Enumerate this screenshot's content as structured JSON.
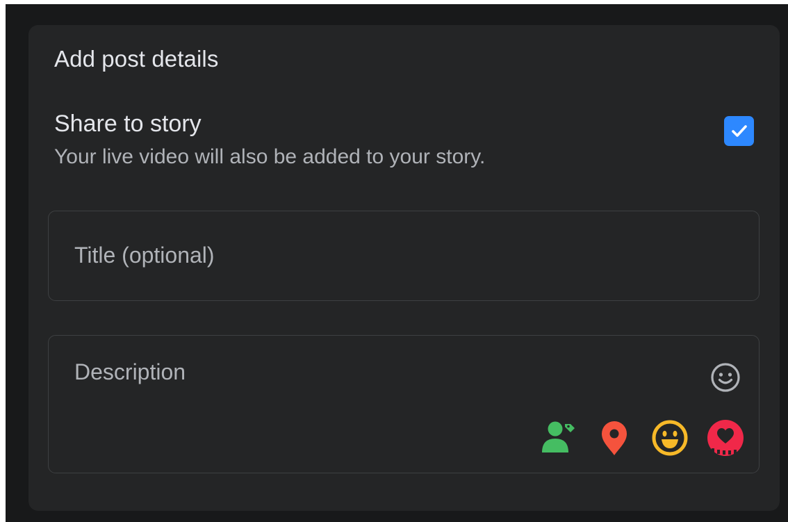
{
  "card": {
    "title": "Add post details"
  },
  "share_to_story": {
    "label": "Share to story",
    "description": "Your live video will also be added to your story.",
    "checked": true
  },
  "title_field": {
    "placeholder": "Title (optional)",
    "value": ""
  },
  "description_field": {
    "placeholder": "Description",
    "value": "",
    "emoji_picker_icon": "smiley-outline-icon"
  },
  "attachment_icons": [
    {
      "name": "tag-people-icon",
      "color": "#45bd62"
    },
    {
      "name": "location-pin-icon",
      "color": "#f5533d"
    },
    {
      "name": "feeling-activity-icon",
      "color": "#f7b928"
    },
    {
      "name": "support-nonprofit-icon",
      "color": "#f02849"
    }
  ],
  "colors": {
    "background": "#18191a",
    "card": "#242526",
    "accent": "#2d88ff",
    "primary_text": "#e4e6eb",
    "secondary_text": "#b0b3b8"
  }
}
